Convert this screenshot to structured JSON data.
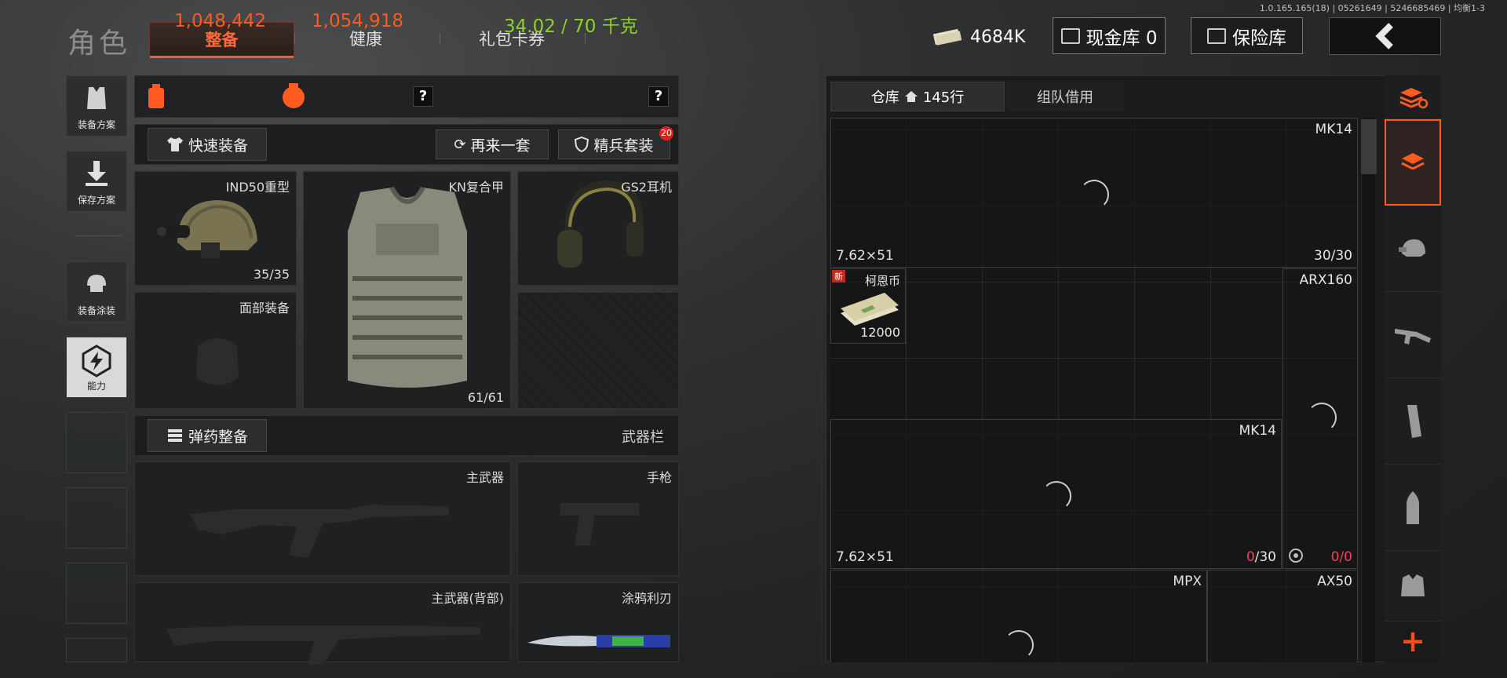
{
  "version": "1.0.165.165(18) | 05261649 | 5246685469 | 均衡1-3",
  "header": {
    "title": "角色",
    "tabs": [
      {
        "label": "整备",
        "active": true
      },
      {
        "label": "健康",
        "active": false
      },
      {
        "label": "礼包卡券",
        "active": false
      }
    ],
    "money": "4684K",
    "cash_vault": "现金库 0",
    "safe": "保险库"
  },
  "sidebar": {
    "items": [
      {
        "label": "装备方案",
        "icon": "vest-icon"
      },
      {
        "label": "保存方案",
        "icon": "download-icon"
      },
      {
        "label": "装备涂装",
        "icon": "helmet-paint-icon"
      },
      {
        "label": "能力",
        "icon": "ability-icon",
        "active": true
      }
    ]
  },
  "stats": {
    "value1": "1,048,442",
    "value2": "1,054,918",
    "weight": "34.02 / 70 千克",
    "help": "?"
  },
  "actions": {
    "quick_equip": "快速装备",
    "again": "再来一套",
    "elite": "精兵套装",
    "elite_badge": "20",
    "ammo": "弹药整备",
    "weapon_bar": "武器栏"
  },
  "slots": {
    "helmet": {
      "name": "IND50重型",
      "dur": "35/35"
    },
    "armor": {
      "name": "KN复合甲",
      "dur": "61/61"
    },
    "headset": {
      "name": "GS2耳机"
    },
    "face": {
      "name": "面部装备"
    },
    "primary": {
      "name": "主武器"
    },
    "pistol": {
      "name": "手枪"
    },
    "primary_back": {
      "name": "主武器(背部)"
    },
    "melee": {
      "name": "涂鸦利刃"
    }
  },
  "warehouse": {
    "tab_warehouse": "仓库",
    "rows": "145行",
    "tab_team": "组队借用",
    "items": [
      {
        "name": "MK14",
        "caliber": "7.62×51",
        "ammo": "30/30"
      },
      {
        "name": "柯恩币",
        "count": "12000",
        "badge": "新"
      },
      {
        "name": "ARX160",
        "ammo_a": "0",
        "ammo_b": "/0"
      },
      {
        "name": "MK14",
        "caliber": "7.62×51",
        "ammo_a": "0",
        "ammo_b": "/30"
      },
      {
        "name": "MPX"
      },
      {
        "name": "AX50"
      }
    ]
  },
  "colors": {
    "accent": "#ff5a1f",
    "weight": "#8ecf2a",
    "empty_ammo": "#ff3c5a"
  },
  "add": "+"
}
